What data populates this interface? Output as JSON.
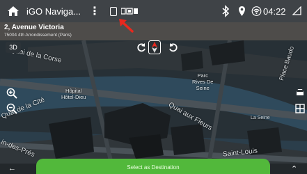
{
  "status_bar": {
    "app_title": "iGO Naviga...",
    "clock": "04:22"
  },
  "address": {
    "street": "2, Avenue Victoria",
    "subtitle": "75004 4th Arrondissement (Paris)"
  },
  "map": {
    "mode_button": "3D",
    "labels": {
      "quai_corse": "Quai de la Corse",
      "quai_cite": "Quai de la Cité",
      "quai_fleurs": "Quai aux Fleurs",
      "saint_louis": "Saint-Louis",
      "place_baudoyer": "Place Baudo",
      "la_seine": "La Seine",
      "des_pres": "in-des-Prés"
    },
    "poi": {
      "hopital_line1": "Hôpital",
      "hopital_line2": "Hôtel-Dieu",
      "parc_line1": "Parc",
      "parc_line2": "Rives De",
      "parc_line3": "Seine"
    }
  },
  "destination_button": "Select as Destination",
  "colors": {
    "accent_green": "#52b83b",
    "annotation_red": "#e8281e",
    "status_bar_bg": "#3f4347",
    "address_bar_bg": "#4e4c4a"
  }
}
